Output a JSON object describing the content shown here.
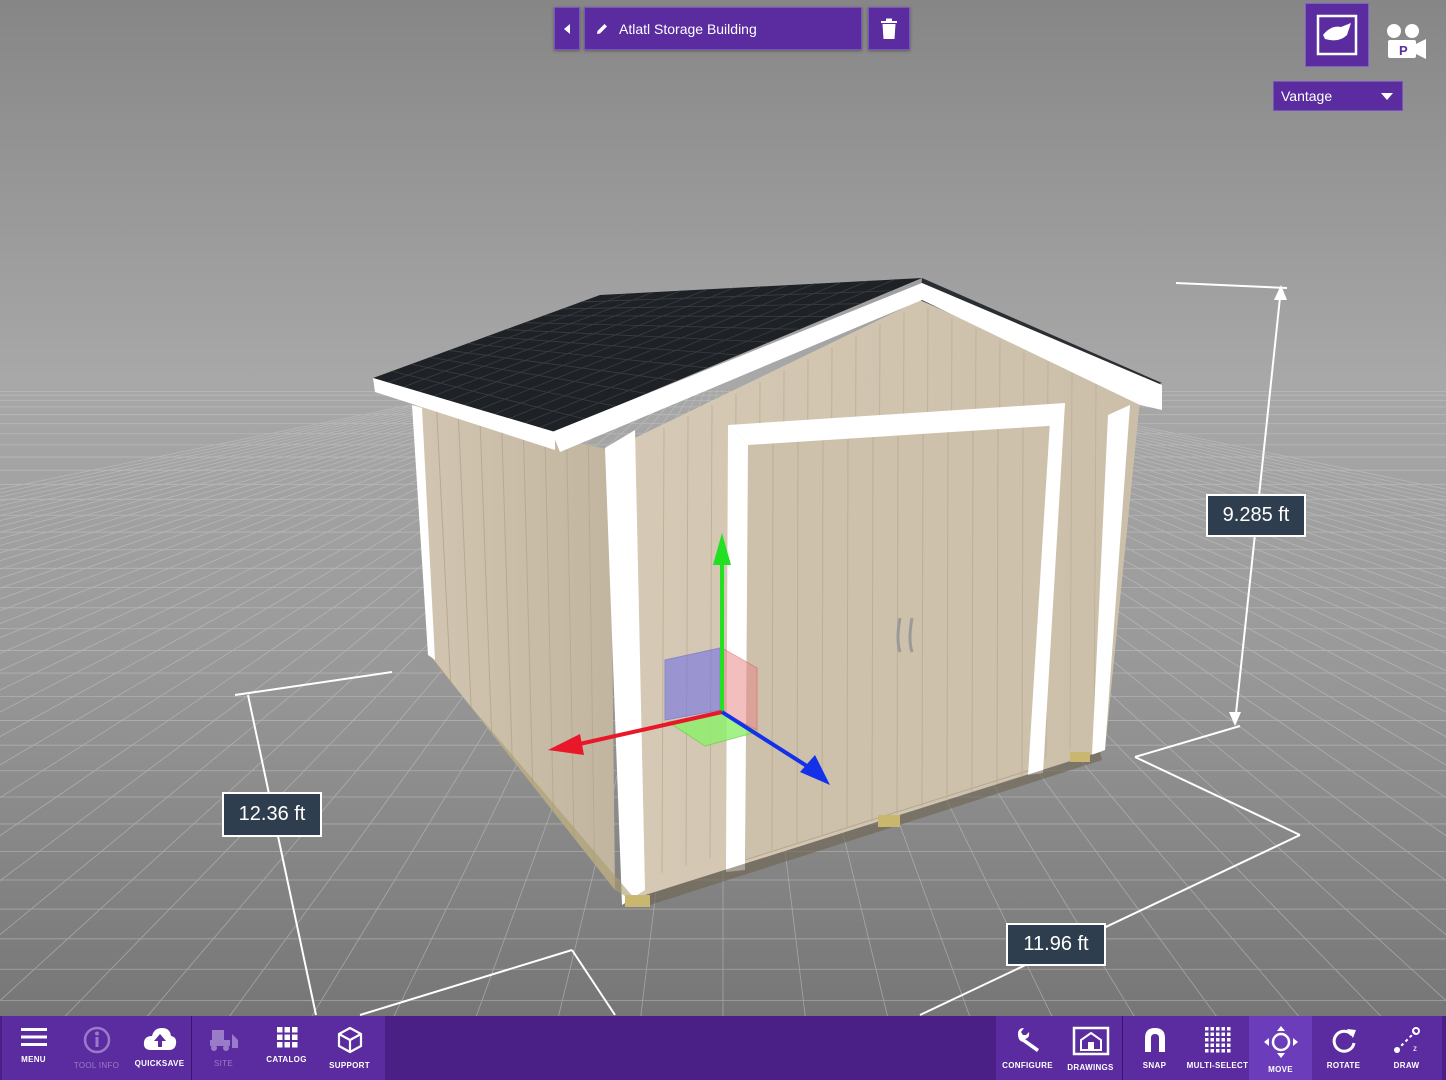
{
  "header": {
    "title": "Atlatl Storage Building"
  },
  "view": {
    "vantage_label": "Vantage"
  },
  "dimensions": {
    "height": "9.285 ft",
    "depth": "12.36 ft",
    "width": "11.96 ft"
  },
  "toolbar": {
    "left": [
      {
        "label": "MENU",
        "icon": "hamburger-icon",
        "enabled": true
      },
      {
        "label": "TOOL INFO",
        "icon": "info-icon",
        "enabled": false
      },
      {
        "label": "QUICKSAVE",
        "icon": "cloud-upload-icon",
        "enabled": true
      },
      {
        "label": "SITE",
        "icon": "bulldozer-icon",
        "enabled": false
      },
      {
        "label": "CATALOG",
        "icon": "grid-icon",
        "enabled": true
      },
      {
        "label": "SUPPORT",
        "icon": "cube-icon",
        "enabled": true
      }
    ],
    "right": [
      {
        "label": "CONFIGURE",
        "icon": "wrench-icon"
      },
      {
        "label": "DRAWINGS",
        "icon": "blueprint-icon"
      },
      {
        "label": "SNAP",
        "icon": "magnet-icon"
      },
      {
        "label": "MULTI-SELECT",
        "icon": "dotted-grid-icon"
      },
      {
        "label": "MOVE",
        "icon": "move-icon",
        "active": true
      },
      {
        "label": "ROTATE",
        "icon": "rotate-icon"
      },
      {
        "label": "DRAW",
        "icon": "draw-icon"
      }
    ]
  },
  "colors": {
    "accent": "#5a2ca0",
    "toolbar_bg": "#4a1f86",
    "label_bg": "#2f3e4e",
    "siding": "#cfc3ae",
    "roof": "#1e2226",
    "trim": "#ffffff",
    "axis_x": "#e8182a",
    "axis_y": "#22e022",
    "axis_z": "#1430e8"
  }
}
